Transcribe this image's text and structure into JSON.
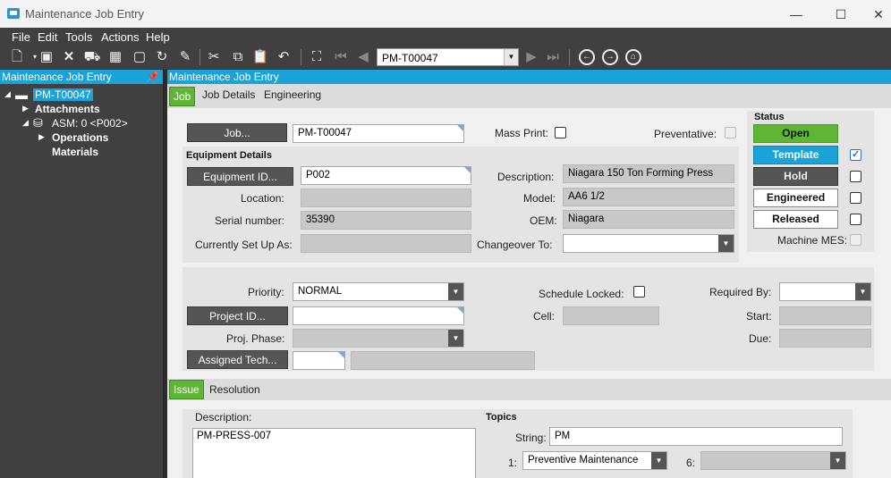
{
  "window": {
    "title": "Maintenance Job Entry",
    "minimize": "—",
    "maximize": "☐",
    "close": "✕"
  },
  "menu": [
    "File",
    "Edit",
    "Tools",
    "Actions",
    "Help"
  ],
  "toolbar": {
    "nav_value": "PM-T00047"
  },
  "tree": {
    "header": "Maintenance Job Entry",
    "root": "PM-T00047",
    "attachments": "Attachments",
    "asm": "ASM: 0 <P002>",
    "operations": "Operations",
    "materials": "Materials"
  },
  "main": {
    "header": "Maintenance Job Entry"
  },
  "tabs": {
    "job": "Job",
    "job_details": "Job Details",
    "engineering": "Engineering"
  },
  "job": {
    "job_button": "Job...",
    "job_value": "PM-T00047",
    "mass_print": "Mass Print:",
    "preventative": "Preventative:"
  },
  "equipment": {
    "title": "Equipment Details",
    "equipment_id_button": "Equipment ID...",
    "equipment_id": "P002",
    "location": "Location:",
    "serial_label": "Serial number:",
    "serial_value": "35390",
    "setup_label": "Currently Set Up As:",
    "description_label": "Description:",
    "description_value": "Niagara 150 Ton Forming Press",
    "model_label": "Model:",
    "model_value": "AA6 1/2",
    "oem_label": "OEM:",
    "oem_value": "Niagara",
    "changeover_label": "Changeover To:"
  },
  "status": {
    "title": "Status",
    "open": "Open",
    "template": "Template",
    "hold": "Hold",
    "engineered": "Engineered",
    "released": "Released",
    "machine_mes": "Machine MES:",
    "template_checked": true
  },
  "schedule": {
    "priority_label": "Priority:",
    "priority_value": "NORMAL",
    "project_button": "Project ID...",
    "phase_label": "Proj. Phase:",
    "assigned_button": "Assigned Tech...",
    "locked_label": "Schedule Locked:",
    "cell_label": "Cell:",
    "required_label": "Required By:",
    "start_label": "Start:",
    "due_label": "Due:"
  },
  "issue_tabs": {
    "issue": "Issue",
    "resolution": "Resolution"
  },
  "issue": {
    "description_label": "Description:",
    "description_value": "PM-PRESS-007",
    "topics_title": "Topics",
    "string_label": "String:",
    "string_value": "PM",
    "topic1_label": "1:",
    "topic1_value": "Preventive Maintenance",
    "topic6_label": "6:"
  }
}
